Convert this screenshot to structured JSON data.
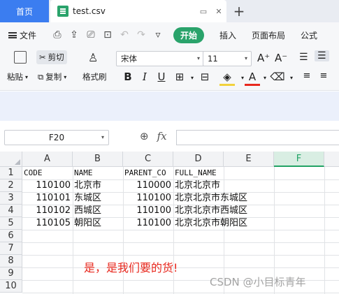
{
  "tabs": {
    "home": "首页",
    "file": "test.csv"
  },
  "menu": {
    "file": "文件",
    "start": "开始",
    "items": [
      "插入",
      "页面布局",
      "公式"
    ]
  },
  "ribbon": {
    "paste": "粘贴",
    "cut": "剪切",
    "copy": "复制",
    "format_painter": "格式刷",
    "font_name": "宋体",
    "font_size": "11",
    "grow_font": "A⁺",
    "shrink_font": "A⁻",
    "bold": "B",
    "italic": "I",
    "underline": "U",
    "font_color": "A"
  },
  "formula_bar": {
    "cell_ref": "F20",
    "fx": "fx",
    "value": ""
  },
  "grid": {
    "columns": [
      "A",
      "B",
      "C",
      "D",
      "E",
      "F"
    ],
    "rows": [
      "1",
      "2",
      "3",
      "4",
      "5",
      "6",
      "7",
      "8",
      "9",
      "10"
    ],
    "data": [
      [
        "CODE",
        "NAME",
        "PARENT_CO",
        "FULL_NAME",
        "",
        ""
      ],
      [
        "110100",
        "北京市",
        "110000",
        "北京北京市",
        "",
        ""
      ],
      [
        "110101",
        "东城区",
        "110100",
        "北京北京市东城区",
        "",
        ""
      ],
      [
        "110102",
        "西城区",
        "110100",
        "北京北京市西城区",
        "",
        ""
      ],
      [
        "110105",
        "朝阳区",
        "110100",
        "北京北京市朝阳区",
        "",
        ""
      ]
    ]
  },
  "annotation": "是，是我们要的货!",
  "watermark": "CSDN @小目标青年",
  "colors": {
    "accent_green": "#2aa36b",
    "home_tab_blue": "#3b7df0",
    "annotation_red": "#e8281e"
  }
}
